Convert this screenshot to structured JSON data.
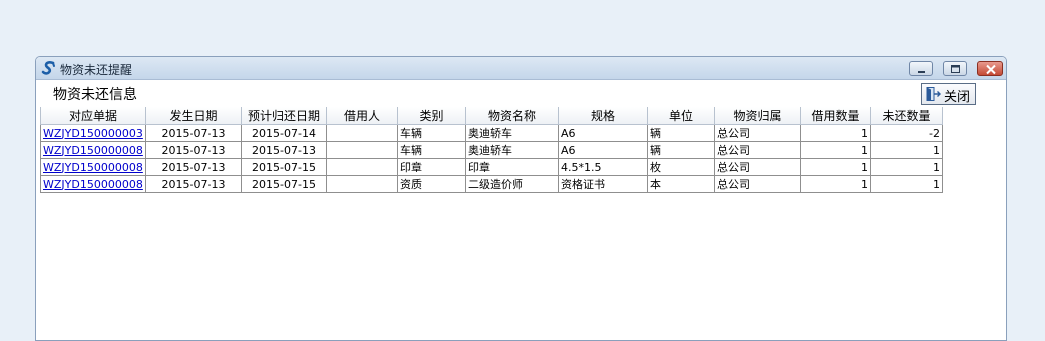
{
  "window": {
    "title": "物资未还提醒",
    "section_label": "物资未还信息",
    "close_button_label": "关闭"
  },
  "table": {
    "columns": [
      "对应单据",
      "发生日期",
      "预计归还日期",
      "借用人",
      "类别",
      "物资名称",
      "规格",
      "单位",
      "物资归属",
      "借用数量",
      "未还数量"
    ],
    "rows": [
      {
        "doc": "WZJYD150000003",
        "date": "2015-07-13",
        "return_date": "2015-07-14",
        "borrower": "",
        "category": "车辆",
        "name": "奥迪轿车",
        "spec": "A6",
        "unit": "辆",
        "owner": "总公司",
        "borrowed": "1",
        "outstanding": "-2"
      },
      {
        "doc": "WZJYD150000008",
        "date": "2015-07-13",
        "return_date": "2015-07-13",
        "borrower": "",
        "category": "车辆",
        "name": "奥迪轿车",
        "spec": "A6",
        "unit": "辆",
        "owner": "总公司",
        "borrowed": "1",
        "outstanding": "1"
      },
      {
        "doc": "WZJYD150000008",
        "date": "2015-07-13",
        "return_date": "2015-07-15",
        "borrower": "",
        "category": "印章",
        "name": "印章",
        "spec": "4.5*1.5",
        "unit": "枚",
        "owner": "总公司",
        "borrowed": "1",
        "outstanding": "1"
      },
      {
        "doc": "WZJYD150000008",
        "date": "2015-07-13",
        "return_date": "2015-07-15",
        "borrower": "",
        "category": "资质",
        "name": "二级造价师",
        "spec": "资格证书",
        "unit": "本",
        "owner": "总公司",
        "borrowed": "1",
        "outstanding": "1"
      }
    ]
  }
}
